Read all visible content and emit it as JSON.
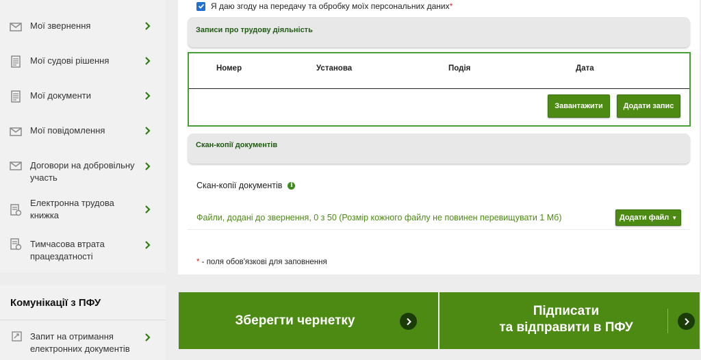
{
  "sidebar": {
    "items": [
      {
        "label": "Мої звернення",
        "icon": "envelope-icon"
      },
      {
        "label": "Мої судові рішення",
        "icon": "document-icon"
      },
      {
        "label": "Мої документи",
        "icon": "document-icon"
      },
      {
        "label": "Мої повідомлення",
        "icon": "envelope-icon"
      },
      {
        "label": "Договори на добровільну участь",
        "icon": "envelope-icon"
      },
      {
        "label": "Електронна трудова книжка",
        "icon": "stamped-document-icon"
      },
      {
        "label": "Тимчасова втрата працездатності",
        "icon": "stamped-document-icon"
      }
    ],
    "section_title": "Комунікації з ПФУ",
    "bottom_items": [
      {
        "label": "Запит на отримання електронних документів",
        "icon": "document-request-icon"
      }
    ]
  },
  "consent": {
    "checked": true,
    "text": "Я даю згоду на передачу та обробку моїх персональних даних",
    "required_mark": "*"
  },
  "employment_section": {
    "title": "Записи про трудову діяльність",
    "columns": [
      "Номер",
      "Установа",
      "Подія",
      "Дата"
    ],
    "rows": [],
    "upload_button": "Завантажити",
    "add_record_button": "Додати запис"
  },
  "scans_section": {
    "title": "Скан-копії документів",
    "label": "Скан-копії документів",
    "files_text": "Файли, додані до звернення, 0 з 50 (Розмір кожного файлу не повинен перевищувати 1 Мб)",
    "add_file_button": "Додати файл",
    "files_added": 0,
    "files_max": 50
  },
  "required_note": {
    "mark": "*",
    "text": " - поля обов'язкові для заповнення"
  },
  "actions": {
    "save_draft": "Зберегти чернетку",
    "sign_line1": "Підписати",
    "sign_line2": "та відправити в ПФУ"
  },
  "colors": {
    "accent_green": "#4c8a14",
    "dark_green": "#1a3c08",
    "heading_green": "#1f5a12",
    "required_red": "#d22222",
    "checkbox_blue": "#1f6fd1"
  }
}
